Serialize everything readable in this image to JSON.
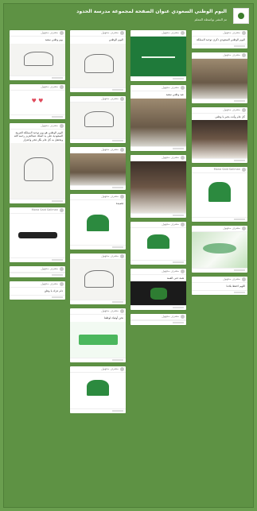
{
  "page": {
    "title": "اليوم الوطني السعودي عنوان الصفحة لمجموعة مدرسة الحدود",
    "subtitle": "تم النشر بواسطة المعلم",
    "bg_color": "#6a9e4f"
  },
  "columns": [
    [
      {
        "author": "مشرف مجهول",
        "text": "يوم وطني سعيد",
        "img": "sketch",
        "h": 40
      },
      {
        "author": "مشرف مجهول",
        "text": "",
        "img": "pinkhearts",
        "h": 30
      },
      {
        "author": "مشرف مجهول",
        "text": "اليوم الوطني هو يوم توحيد المملكة العربية السعودية على يد الملك عبدالعزيز رحمه الله ونحتفل به كل عام بكل فخر واعتزاز",
        "img": "sketch",
        "h": 70
      },
      {
        "author": "Mona Said Sallman",
        "text": "",
        "img": "callig",
        "h": 55
      },
      {
        "author": "مشرف مجهول",
        "text": "",
        "img": "",
        "h": 0
      },
      {
        "author": "مشرف مجهول",
        "text": "دام عزك يا وطن",
        "img": "",
        "h": 0
      }
    ],
    [
      {
        "author": "مشرف مجهول",
        "text": "اليوم الوطني",
        "img": "sketch",
        "h": 55
      },
      {
        "author": "مشرف مجهول",
        "text": "",
        "img": "sketch",
        "h": 45
      },
      {
        "author": "مشرف مجهول",
        "text": "",
        "img": "photo",
        "h": 40
      },
      {
        "author": "مشرف مجهول",
        "text": "قصيدة",
        "img": "logo-green",
        "h": 48
      },
      {
        "author": "مشرف مجهول",
        "text": "",
        "img": "sketch",
        "h": 50
      },
      {
        "author": "مشرف مجهول",
        "text": "نحن أوفياء لوطننا",
        "img": "greenwide",
        "h": 45
      },
      {
        "author": "مشرف مجهول",
        "text": "",
        "img": "logo-green",
        "h": 45
      }
    ],
    [
      {
        "author": "مشرف مجهول",
        "text": "",
        "img": "flag",
        "h": 50
      },
      {
        "author": "مشرف مجهول",
        "text": "عيد وطني سعيد",
        "img": "photo",
        "h": 60
      },
      {
        "author": "مشرف مجهول",
        "text": "",
        "img": "photo2",
        "h": 65
      },
      {
        "author": "مشرف مجهول",
        "text": "",
        "img": "logo-green",
        "h": 40
      },
      {
        "author": "مشرف مجهول",
        "text": "همة حتى القمة",
        "img": "dark",
        "h": 30
      },
      {
        "author": "مشرف مجهول",
        "text": "",
        "img": "",
        "h": 0
      }
    ],
    [
      {
        "author": "مشرف مجهول",
        "text": "اليوم الوطني السعودي ذكرى توحيد المملكة",
        "img": "",
        "h": 0
      },
      {
        "author": "مشرف مجهول",
        "text": "",
        "img": "photo",
        "h": 50
      },
      {
        "author": "مشرف مجهول",
        "text": "كل عام وأنت بخير يا وطني",
        "img": "photo2",
        "h": 48
      },
      {
        "author": "Mona Said Sallman",
        "text": "",
        "img": "logo-green",
        "h": 55
      },
      {
        "author": "مشرف مجهول",
        "text": "",
        "img": "watercolor",
        "h": 45
      },
      {
        "author": "مشرف مجهول",
        "text": "اللهم احفظ بلادنا",
        "img": "",
        "h": 0
      }
    ]
  ]
}
